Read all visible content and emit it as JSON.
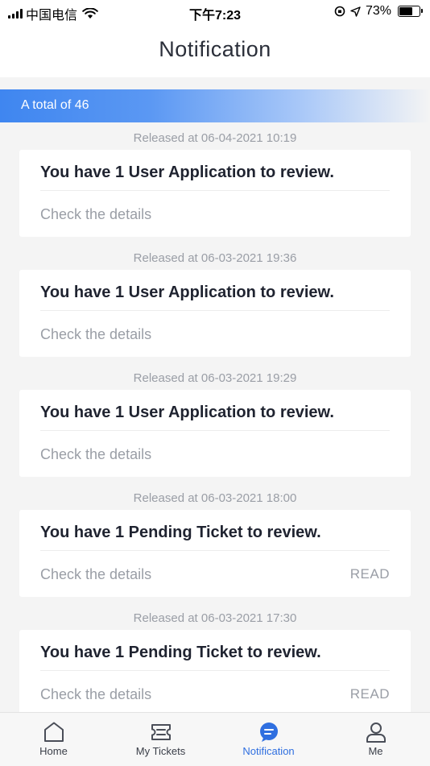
{
  "status_bar": {
    "carrier": "中国电信",
    "time": "下午7:23",
    "battery": "73%",
    "battery_level": 0.73
  },
  "header": {
    "title": "Notification"
  },
  "banner": {
    "total_text": "A total of 46"
  },
  "notifications": [
    {
      "released": "Released at 06-04-2021 10:19",
      "title": "You have 1 User Application to review.",
      "link": "Check the details",
      "status": ""
    },
    {
      "released": "Released at 06-03-2021 19:36",
      "title": "You have 1 User Application to review.",
      "link": "Check the details",
      "status": ""
    },
    {
      "released": "Released at 06-03-2021 19:29",
      "title": "You have 1 User Application to review.",
      "link": "Check the details",
      "status": ""
    },
    {
      "released": "Released at 06-03-2021 18:00",
      "title": "You have 1 Pending Ticket to review.",
      "link": "Check the details",
      "status": "READ"
    },
    {
      "released": "Released at 06-03-2021 17:30",
      "title": "You have 1 Pending Ticket to review.",
      "link": "Check the details",
      "status": "READ"
    }
  ],
  "tabs": [
    {
      "label": "Home",
      "icon": "home-icon",
      "active": false
    },
    {
      "label": "My Tickets",
      "icon": "ticket-icon",
      "active": false
    },
    {
      "label": "Notification",
      "icon": "notification-icon",
      "active": true
    },
    {
      "label": "Me",
      "icon": "user-icon",
      "active": false
    }
  ],
  "colors": {
    "accent": "#2f6fe0",
    "banner_start": "#3f86f0",
    "muted_text": "#9a9ea6"
  }
}
